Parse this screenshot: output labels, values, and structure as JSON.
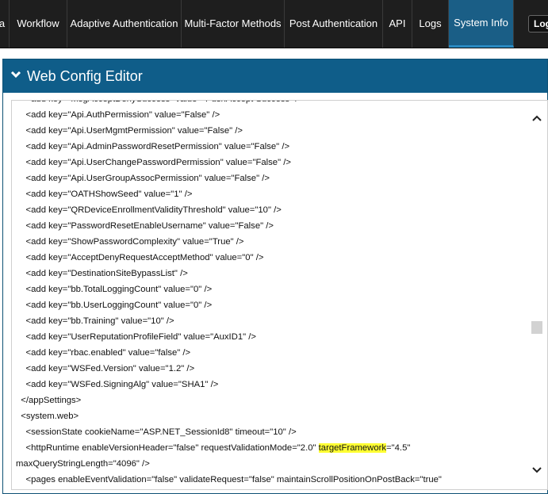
{
  "nav": {
    "tabs": [
      {
        "label": "a"
      },
      {
        "label": "Workflow"
      },
      {
        "label": "Adaptive Authentication"
      },
      {
        "label": "Multi-Factor Methods"
      },
      {
        "label": "Post Authentication"
      },
      {
        "label": "API"
      },
      {
        "label": "Logs"
      },
      {
        "label": "System Info",
        "active": true
      }
    ],
    "logout_label": "Logout"
  },
  "panel": {
    "title": "Web Config Editor"
  },
  "editor": {
    "lines": [
      "    <add key=\"MsgAcceptDenySuccess\" value=\"PushAccept Success\" />",
      "    <add key=\"Api.AuthPermission\" value=\"False\" />",
      "    <add key=\"Api.UserMgmtPermission\" value=\"False\" />",
      "    <add key=\"Api.AdminPasswordResetPermission\" value=\"False\" />",
      "    <add key=\"Api.UserChangePasswordPermission\" value=\"False\" />",
      "    <add key=\"Api.UserGroupAssocPermission\" value=\"False\" />",
      "    <add key=\"OATHShowSeed\" value=\"1\" />",
      "    <add key=\"QRDeviceEnrollmentValidityThreshold\" value=\"10\" />",
      "    <add key=\"PasswordResetEnableUsername\" value=\"False\" />",
      "    <add key=\"ShowPasswordComplexity\" value=\"True\" />",
      "    <add key=\"AcceptDenyRequestAcceptMethod\" value=\"0\" />",
      "    <add key=\"DestinationSiteBypassList\" />",
      "    <add key=\"bb.TotalLoggingCount\" value=\"0\" />",
      "    <add key=\"bb.UserLoggingCount\" value=\"0\" />",
      "    <add key=\"bb.Training\" value=\"10\" />",
      "    <add key=\"UserReputationProfileField\" value=\"AuxID1\" />",
      "    <add key=\"rbac.enabled\" value=\"false\" />",
      "    <add key=\"WSFed.Version\" value=\"1.2\" />",
      "    <add key=\"WSFed.SigningAlg\" value=\"SHA1\" />",
      "  </appSettings>",
      "  <system.web>",
      "    <sessionState cookieName=\"ASP.NET_SessionId8\" timeout=\"10\" />"
    ],
    "http_runtime": {
      "before": "    <httpRuntime enableVersionHeader=\"false\" requestValidationMode=\"2.0\" ",
      "highlight": "targetFramework",
      "after": "=\"4.5\"",
      "continuation": "maxQueryStringLength=\"4096\" />"
    },
    "last_line": "    <pages enableEventValidation=\"false\" validateRequest=\"false\" maintainScrollPositionOnPostBack=\"true\""
  }
}
